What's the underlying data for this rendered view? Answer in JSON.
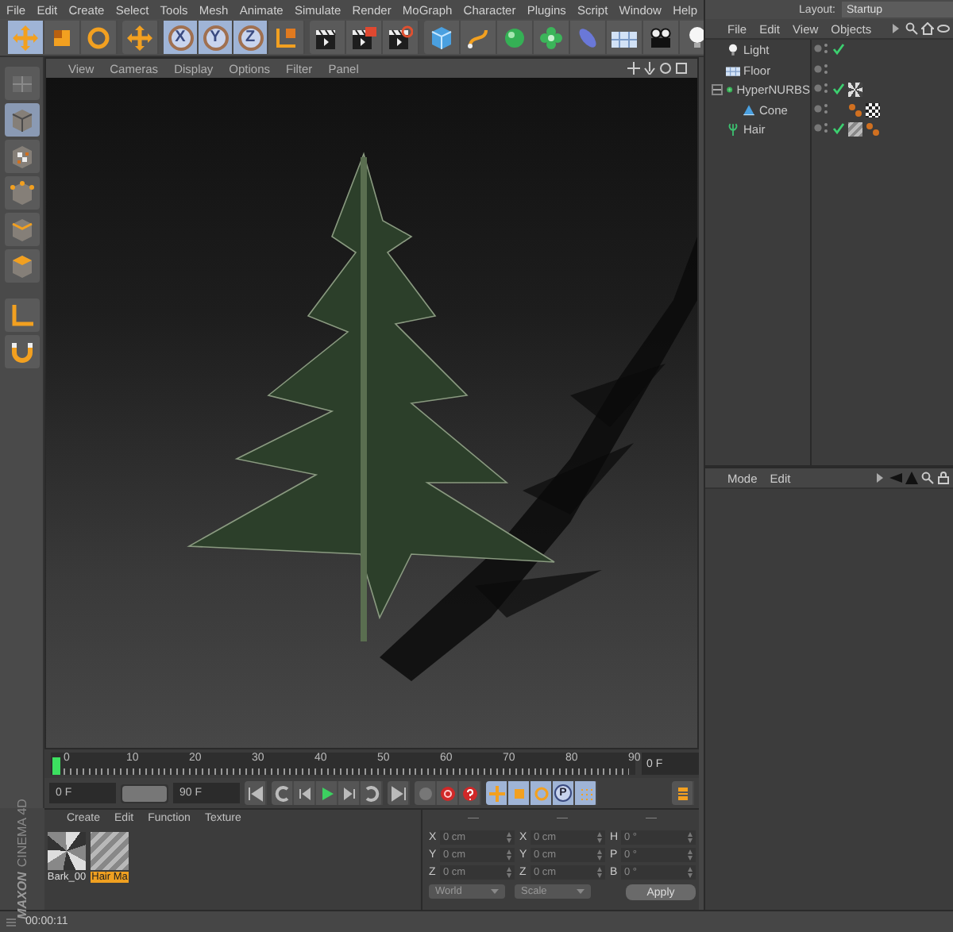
{
  "menu_bar": {
    "items": [
      "File",
      "Edit",
      "Create",
      "Select",
      "Tools",
      "Mesh",
      "Animate",
      "Simulate",
      "Render",
      "MoGraph",
      "Character",
      "Plugins",
      "Script",
      "Window",
      "Help"
    ]
  },
  "layout": {
    "label": "Layout:",
    "value": "Startup"
  },
  "toolbar": {
    "tools": [
      {
        "kind": "move",
        "selected": true
      },
      {
        "kind": "scale",
        "selected": false
      },
      {
        "kind": "rotate",
        "selected": false
      },
      {
        "kind": "move",
        "selected": false
      }
    ],
    "axes": [
      {
        "label": "X",
        "selected": true
      },
      {
        "label": "Y",
        "selected": true
      },
      {
        "label": "Z",
        "selected": true
      }
    ]
  },
  "mode_palette": [
    {
      "kind": "panel",
      "selected": false
    },
    {
      "kind": "model",
      "selected": true
    },
    {
      "kind": "texture",
      "selected": false
    },
    {
      "kind": "points",
      "selected": false
    },
    {
      "kind": "edges",
      "selected": false
    },
    {
      "kind": "polygons",
      "selected": false
    },
    {
      "kind": "axis",
      "selected": false
    },
    {
      "kind": "snap",
      "selected": false
    }
  ],
  "viewport": {
    "menu": [
      "View",
      "Cameras",
      "Display",
      "Options",
      "Filter",
      "Panel"
    ]
  },
  "object_manager": {
    "menu": [
      "File",
      "Edit",
      "View",
      "Objects"
    ],
    "objects": [
      {
        "kind": "light",
        "name": "Light",
        "enabled": true
      },
      {
        "kind": "floor",
        "name": "Floor",
        "enabled": false
      },
      {
        "kind": "hypernurbs",
        "name": "HyperNURBS",
        "enabled": true,
        "expanded": true,
        "tags": [
          {
            "kind": "bark"
          }
        ],
        "children": [
          {
            "kind": "cone",
            "name": "Cone",
            "enabled": false,
            "tags": [
              {
                "kind": "dots"
              },
              {
                "kind": "checker"
              }
            ]
          }
        ]
      },
      {
        "kind": "hair",
        "name": "Hair",
        "enabled": true,
        "tags": [
          {
            "kind": "hair"
          },
          {
            "kind": "dots"
          }
        ]
      }
    ]
  },
  "attribute_manager": {
    "menu": [
      "Mode",
      "Edit"
    ]
  },
  "timeline": {
    "labels": [
      "0",
      "10",
      "20",
      "30",
      "40",
      "50",
      "60",
      "70",
      "80",
      "90"
    ],
    "playhead": {
      "level": 0
    },
    "current_frame": "0 F"
  },
  "transport": {
    "start": "0 F",
    "range_slider": {
      "level": 1
    },
    "end": "90 F",
    "parameter_key": "P"
  },
  "material_manager": {
    "menu": [
      "Create",
      "Edit",
      "Function",
      "Texture"
    ],
    "materials": [
      {
        "kind": "bark",
        "name": "Bark_00",
        "selected": false
      },
      {
        "kind": "hair",
        "name": "Hair Ma",
        "selected": true
      }
    ]
  },
  "coordinates": {
    "headers": [
      "—",
      "—",
      "—"
    ],
    "rows": [
      {
        "cells": [
          {
            "axis": "X",
            "value": "0 cm"
          },
          {
            "axis": "X",
            "value": "0 cm"
          },
          {
            "axis": "H",
            "value": "0 °"
          }
        ]
      },
      {
        "cells": [
          {
            "axis": "Y",
            "value": "0 cm"
          },
          {
            "axis": "Y",
            "value": "0 cm"
          },
          {
            "axis": "P",
            "value": "0 °"
          }
        ]
      },
      {
        "cells": [
          {
            "axis": "Z",
            "value": "0 cm"
          },
          {
            "axis": "Z",
            "value": "0 cm"
          },
          {
            "axis": "B",
            "value": "0 °"
          }
        ]
      }
    ],
    "dropdowns": [
      "World",
      "Scale"
    ],
    "apply": "Apply"
  },
  "logo": {
    "brand": "MAXON",
    "product": "CINEMA 4D"
  },
  "status_bar": {
    "time": "00:00:11"
  }
}
